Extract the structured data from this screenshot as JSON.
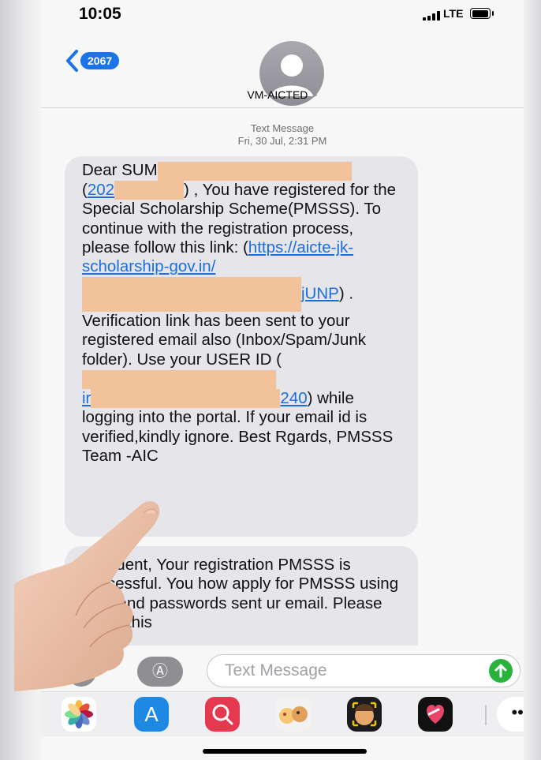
{
  "status_bar": {
    "time": "10:05",
    "network": "LTE"
  },
  "header": {
    "back_count": "2067",
    "contact_name": "VM-AICTED",
    "chevron": ">"
  },
  "thread": {
    "label": "Text Message",
    "timestamp": "Fri, 30 Jul, 2:31 PM"
  },
  "message1": {
    "p1": "Dear SUM",
    "p2a": "(",
    "p2_link": "202",
    "p2b": ") , You have registered for the Special Scholarship Scheme(PMSSS). To continue with the registration process, please follow this link: (",
    "link1": "https://aicte-jk-scholarship-gov.in/",
    "link2": "jUNP",
    "p3": ") . Verification link has been sent to your registered email also (Inbox/Spam/Junk folder). Use your USER ID (",
    "link3": "ir",
    "link4": "240",
    "p4": ") while logging into the portal. If your email id is verified,kindly ignore. Best R",
    "p5": "gards, PMSSS Team -AIC"
  },
  "message2": {
    "text": "r Student, Your registration PMSSS is successful. You how apply for PMSSS using ame and passwords sent ur email. Please share this"
  },
  "compose": {
    "placeholder": "Text Message"
  },
  "app_strip": {
    "more": "•••"
  },
  "colors": {
    "accent": "#1a73e8",
    "send": "#29b33c",
    "bubble": "#e5e5ea",
    "redaction": "#f2c39a"
  }
}
